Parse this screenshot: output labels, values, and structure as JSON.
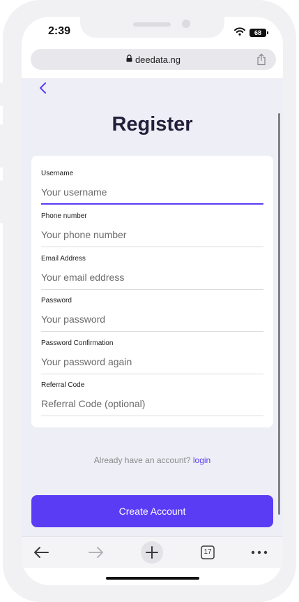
{
  "status": {
    "time": "2:39",
    "battery": "68"
  },
  "browser": {
    "url": "deedata.ng",
    "tab_count": "17"
  },
  "page": {
    "title": "Register",
    "fields": [
      {
        "label": "Username",
        "placeholder": "Your username"
      },
      {
        "label": "Phone number",
        "placeholder": "Your phone number"
      },
      {
        "label": "Email Address",
        "placeholder": "Your email eddress"
      },
      {
        "label": "Password",
        "placeholder": "Your password"
      },
      {
        "label": "Password Confirmation",
        "placeholder": "Your password again"
      },
      {
        "label": "Referral Code",
        "placeholder": "Referral Code (optional)"
      }
    ],
    "login_prompt": "Already have an account?",
    "login_link": "login",
    "submit_label": "Create Account"
  },
  "colors": {
    "accent": "#5b3cf5",
    "page_bg": "#eeeef6",
    "title": "#231f3a"
  },
  "icons": [
    "wifi-icon",
    "battery-icon",
    "lock-icon",
    "share-icon",
    "back-chevron-icon",
    "back-arrow-icon",
    "forward-arrow-icon",
    "plus-icon",
    "tabs-icon",
    "more-icon"
  ]
}
